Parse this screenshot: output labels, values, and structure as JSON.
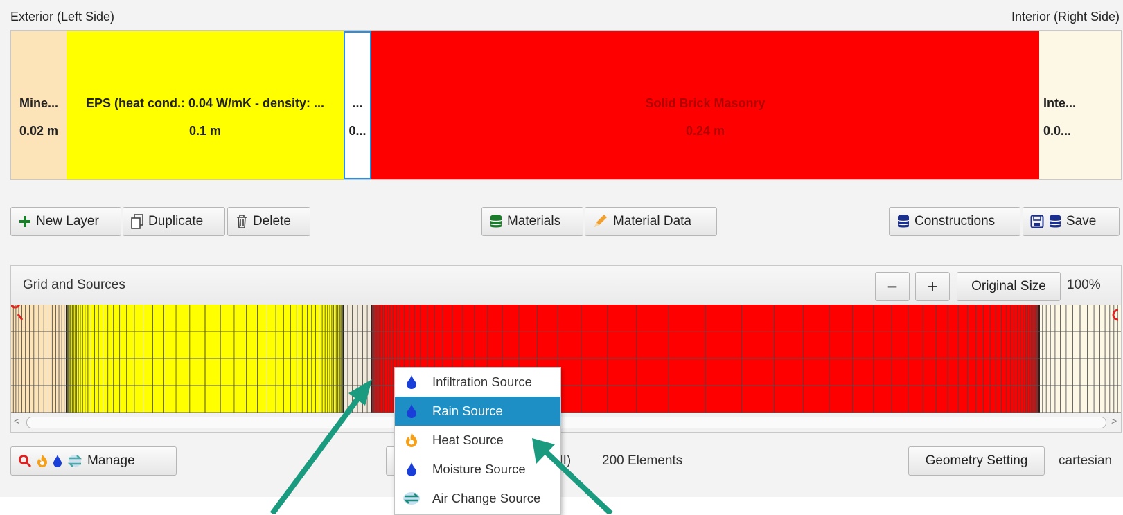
{
  "header": {
    "left_label": "Exterior (Left Side)",
    "right_label": "Interior (Right Side)"
  },
  "layers": [
    {
      "name": "Mine...",
      "thickness": "0.02 m",
      "color": "#fde3b8"
    },
    {
      "name": "EPS (heat cond.: 0.04 W/mK - density: ...",
      "thickness": "0.1 m",
      "color": "#ffff00"
    },
    {
      "name": "...",
      "thickness": "0...",
      "color": "#ffffff"
    },
    {
      "name": "Solid Brick Masonry",
      "thickness": "0.24 m",
      "color": "#ff0000"
    },
    {
      "name": "Inte...",
      "thickness": "0.0...",
      "color": "#fdf7e6"
    }
  ],
  "toolbar": {
    "new_layer": "New Layer",
    "duplicate": "Duplicate",
    "delete": "Delete",
    "materials": "Materials",
    "material_data": "Material Data",
    "constructions": "Constructions",
    "save": "Save"
  },
  "grid_panel": {
    "title": "Grid and Sources",
    "zoom_out": "−",
    "zoom_in": "+",
    "original_size": "Original Size",
    "zoom_level": "100%"
  },
  "bottom_bar": {
    "manage": "Manage",
    "grid_info_partial": "(II)",
    "elements": "200 Elements",
    "geometry_setting": "Geometry Setting",
    "geometry_type": "cartesian"
  },
  "context_menu": {
    "items": [
      {
        "label": "Infiltration Source",
        "icon": "water-drop-icon",
        "selected": false
      },
      {
        "label": "Rain Source",
        "icon": "water-drop-icon",
        "selected": true
      },
      {
        "label": "Heat Source",
        "icon": "flame-icon",
        "selected": false
      },
      {
        "label": "Moisture Source",
        "icon": "water-drop-icon",
        "selected": false
      },
      {
        "label": "Air Change Source",
        "icon": "air-exchange-icon",
        "selected": false
      }
    ]
  },
  "colors": {
    "mineral": "#fde3b8",
    "eps": "#ffff00",
    "brick": "#ff0000",
    "interior": "#fdf7e6",
    "selection": "#1e8fc4",
    "arrow": "#1a9a7e",
    "db_icon": "#1b7d2c",
    "constructions_icon": "#1b2f8f"
  }
}
